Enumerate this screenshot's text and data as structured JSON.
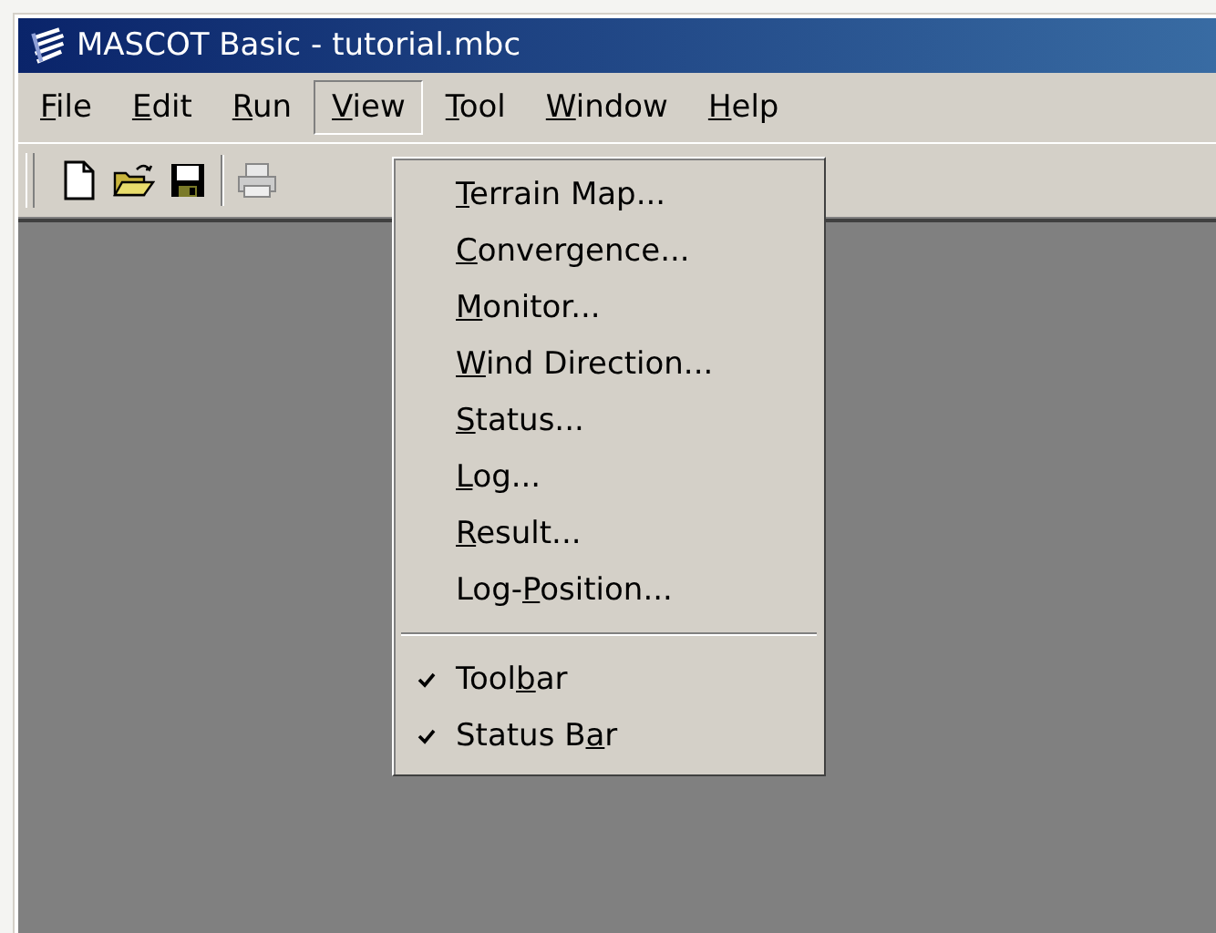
{
  "window": {
    "title": "MASCOT Basic - tutorial.mbc"
  },
  "menubar": [
    {
      "key": "F",
      "post": "ile",
      "selected": false
    },
    {
      "key": "E",
      "post": "dit",
      "selected": false
    },
    {
      "key": "R",
      "post": "un",
      "selected": false
    },
    {
      "key": "V",
      "post": "iew",
      "selected": true
    },
    {
      "key": "T",
      "post": "ool",
      "selected": false
    },
    {
      "key": "W",
      "post": "indow",
      "selected": false
    },
    {
      "key": "H",
      "post": "elp",
      "selected": false
    }
  ],
  "view_menu": [
    {
      "kind": "command",
      "key": "T",
      "post": "errain Map..."
    },
    {
      "kind": "command",
      "key": "C",
      "post": "onvergence..."
    },
    {
      "kind": "command",
      "key": "M",
      "post": "onitor..."
    },
    {
      "kind": "command",
      "key": "W",
      "post": "ind Direction..."
    },
    {
      "kind": "command",
      "key": "S",
      "post": "tatus..."
    },
    {
      "kind": "command",
      "key": "L",
      "post": "og..."
    },
    {
      "kind": "command",
      "key": "R",
      "post": "esult..."
    },
    {
      "kind": "command",
      "pre": "Log-",
      "key": "P",
      "post": "osition..."
    },
    {
      "kind": "separator"
    },
    {
      "kind": "toggle",
      "checked": true,
      "pre": "Tool",
      "key": "b",
      "post": "ar"
    },
    {
      "kind": "toggle",
      "checked": true,
      "pre": "Status B",
      "key": "a",
      "post": "r"
    }
  ]
}
